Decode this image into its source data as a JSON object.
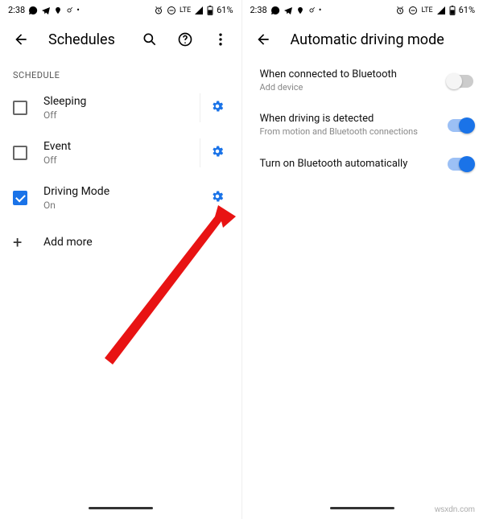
{
  "status": {
    "time": "2:38",
    "right_text": "61%",
    "lte": "LTE"
  },
  "left": {
    "title": "Schedules",
    "section": "SCHEDULE",
    "items": [
      {
        "label": "Sleeping",
        "state": "Off",
        "checked": false
      },
      {
        "label": "Event",
        "state": "Off",
        "checked": false
      },
      {
        "label": "Driving Mode",
        "state": "On",
        "checked": true
      }
    ],
    "add_more": "Add more"
  },
  "right": {
    "title": "Automatic driving mode",
    "items": [
      {
        "label": "When connected to Bluetooth",
        "sub": "Add device",
        "on": false
      },
      {
        "label": "When driving is detected",
        "sub": "From motion and Bluetooth connections",
        "on": true
      },
      {
        "label": "Turn on Bluetooth automatically",
        "sub": "",
        "on": true
      }
    ]
  },
  "watermark": "wsxdn.com"
}
